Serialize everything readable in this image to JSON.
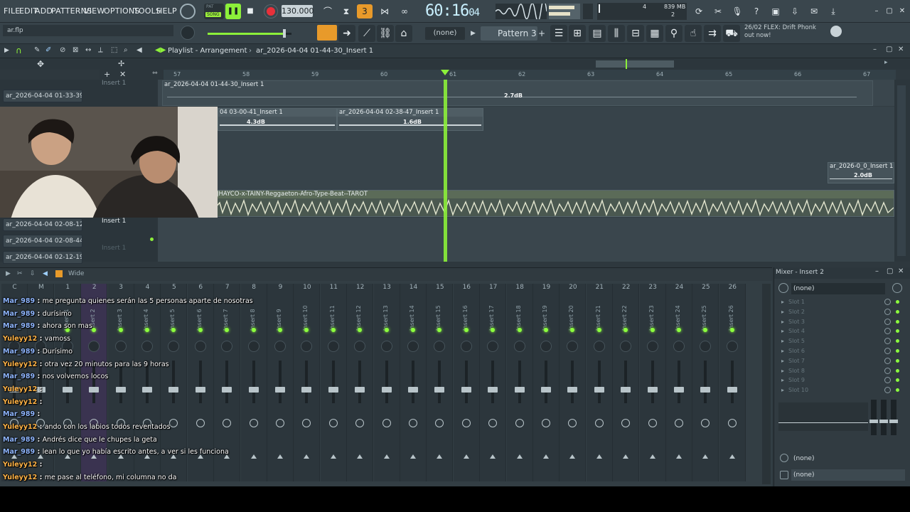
{
  "menu": [
    "FILE",
    "EDIT",
    "ADD",
    "PATTERNS",
    "VIEW",
    "OPTIONS",
    "TOOLS",
    "HELP"
  ],
  "transport": {
    "song_label": "SONG",
    "pat_label": "PAT",
    "bpm": "130.000",
    "time": "60:16",
    "time_ticks": "04"
  },
  "system": {
    "memory": "839 MB",
    "cpu_top": "4",
    "cpu_bottom": "2"
  },
  "project": {
    "filename": "ar.flp",
    "pattern": "Pattern 3",
    "pattern_none": "(none)"
  },
  "news": {
    "line1": "26/02  FLEX: Drift Phonk",
    "line2": "out now!"
  },
  "playlist": {
    "title": "Playlist - Arrangement",
    "breadcrumb": "ar_2026-04-04 01-44-30_Insert 1",
    "ruler": [
      "57",
      "58",
      "59",
      "60",
      "61",
      "62",
      "63",
      "64",
      "65",
      "66",
      "67"
    ],
    "track_labels": [
      "ar_2026-04-04 01-33-39...",
      "ar_2026-04-04 02-08-12...",
      "ar_2026-04-04 02-08-44...",
      "ar_2026-04-04 02-12-19..."
    ],
    "lane_insert": "Insert 1",
    "lane_insert_dim": "Insert 1",
    "clips": {
      "c1": "ar_2026-04-04 01-44-30_Insert 1",
      "c1_db": "2.7dB",
      "c2": "04 03-00-41_Insert 1",
      "c2_db": "4.3dB",
      "c3": "ar_2026-04-04 02-38-47_Insert 1",
      "c3_db": "1.6dB",
      "c4": "ar_2026-0_0_Insert 1",
      "c4_db": "2.0dB",
      "c5": "JHAYCO-x-TAINY-Reggaeton-Afro-Type-Beat--TAROT"
    }
  },
  "mixer": {
    "title": "Wide",
    "channel_numbers": [
      "C",
      "M",
      "1",
      "2",
      "3",
      "4",
      "5",
      "6",
      "7",
      "8",
      "9",
      "10",
      "11",
      "12",
      "13",
      "14",
      "15",
      "16",
      "17",
      "18",
      "19",
      "20",
      "21",
      "22",
      "23",
      "24",
      "25",
      "26"
    ],
    "channel_names": [
      "",
      "",
      "Insert 1",
      "Insert 2",
      "Insert 3",
      "Insert 4",
      "Insert 5",
      "Insert 6",
      "Insert 7",
      "Insert 8",
      "Insert 9",
      "Insert 10",
      "Insert 11",
      "Insert 12",
      "Insert 13",
      "Insert 14",
      "Insert 15",
      "Insert 16",
      "Insert 17",
      "Insert 18",
      "Insert 19",
      "Insert 20",
      "Insert 21",
      "Insert 22",
      "Insert 23",
      "Insert 24",
      "Insert 25",
      "Insert 26"
    ],
    "panel_title": "Mixer - Insert 2",
    "input_none": "(none)",
    "output_none": "(none)",
    "output_none2": "(none)",
    "slots": [
      "Slot 1",
      "Slot 2",
      "Slot 3",
      "Slot 4",
      "Slot 5",
      "Slot 6",
      "Slot 7",
      "Slot 8",
      "Slot 9",
      "Slot 10"
    ]
  },
  "chat": [
    {
      "user": "Mar_989",
      "color": "#8fb6ff",
      "text": "me pregunta quienes serán las 5 personas aparte de nosotras"
    },
    {
      "user": "Mar_989",
      "color": "#8fb6ff",
      "text": "durísimo"
    },
    {
      "user": "Mar_989",
      "color": "#8fb6ff",
      "text": "ahora son mas"
    },
    {
      "user": "Yuleyy12",
      "color": "#ffb347",
      "text": "vamoss"
    },
    {
      "user": "Mar_989",
      "color": "#8fb6ff",
      "text": "Durísimo"
    },
    {
      "user": "Yuleyy12",
      "color": "#ffb347",
      "text": "otra vez 20 minutos para las 9 horas"
    },
    {
      "user": "Mar_989",
      "color": "#8fb6ff",
      "text": "nos volvemos locos"
    },
    {
      "user": "Yuleyy12",
      "color": "#ffb347",
      "text": ""
    },
    {
      "user": "Yuleyy12",
      "color": "#ffb347",
      "text": ""
    },
    {
      "user": "Mar_989",
      "color": "#8fb6ff",
      "text": ""
    },
    {
      "user": "Yuleyy12",
      "color": "#ffb347",
      "text": "ando con los labios todos reventados"
    },
    {
      "user": "Mar_989",
      "color": "#8fb6ff",
      "text": "Andrés dice que le chupes la geta"
    },
    {
      "user": "Mar_989",
      "color": "#8fb6ff",
      "text": "lean lo que yo había escrito antes, a ver si les funciona"
    },
    {
      "user": "Yuleyy12",
      "color": "#ffb347",
      "text": ""
    },
    {
      "user": "Yuleyy12",
      "color": "#ffb347",
      "text": "me pase al teléfono, mi columna no da"
    }
  ]
}
